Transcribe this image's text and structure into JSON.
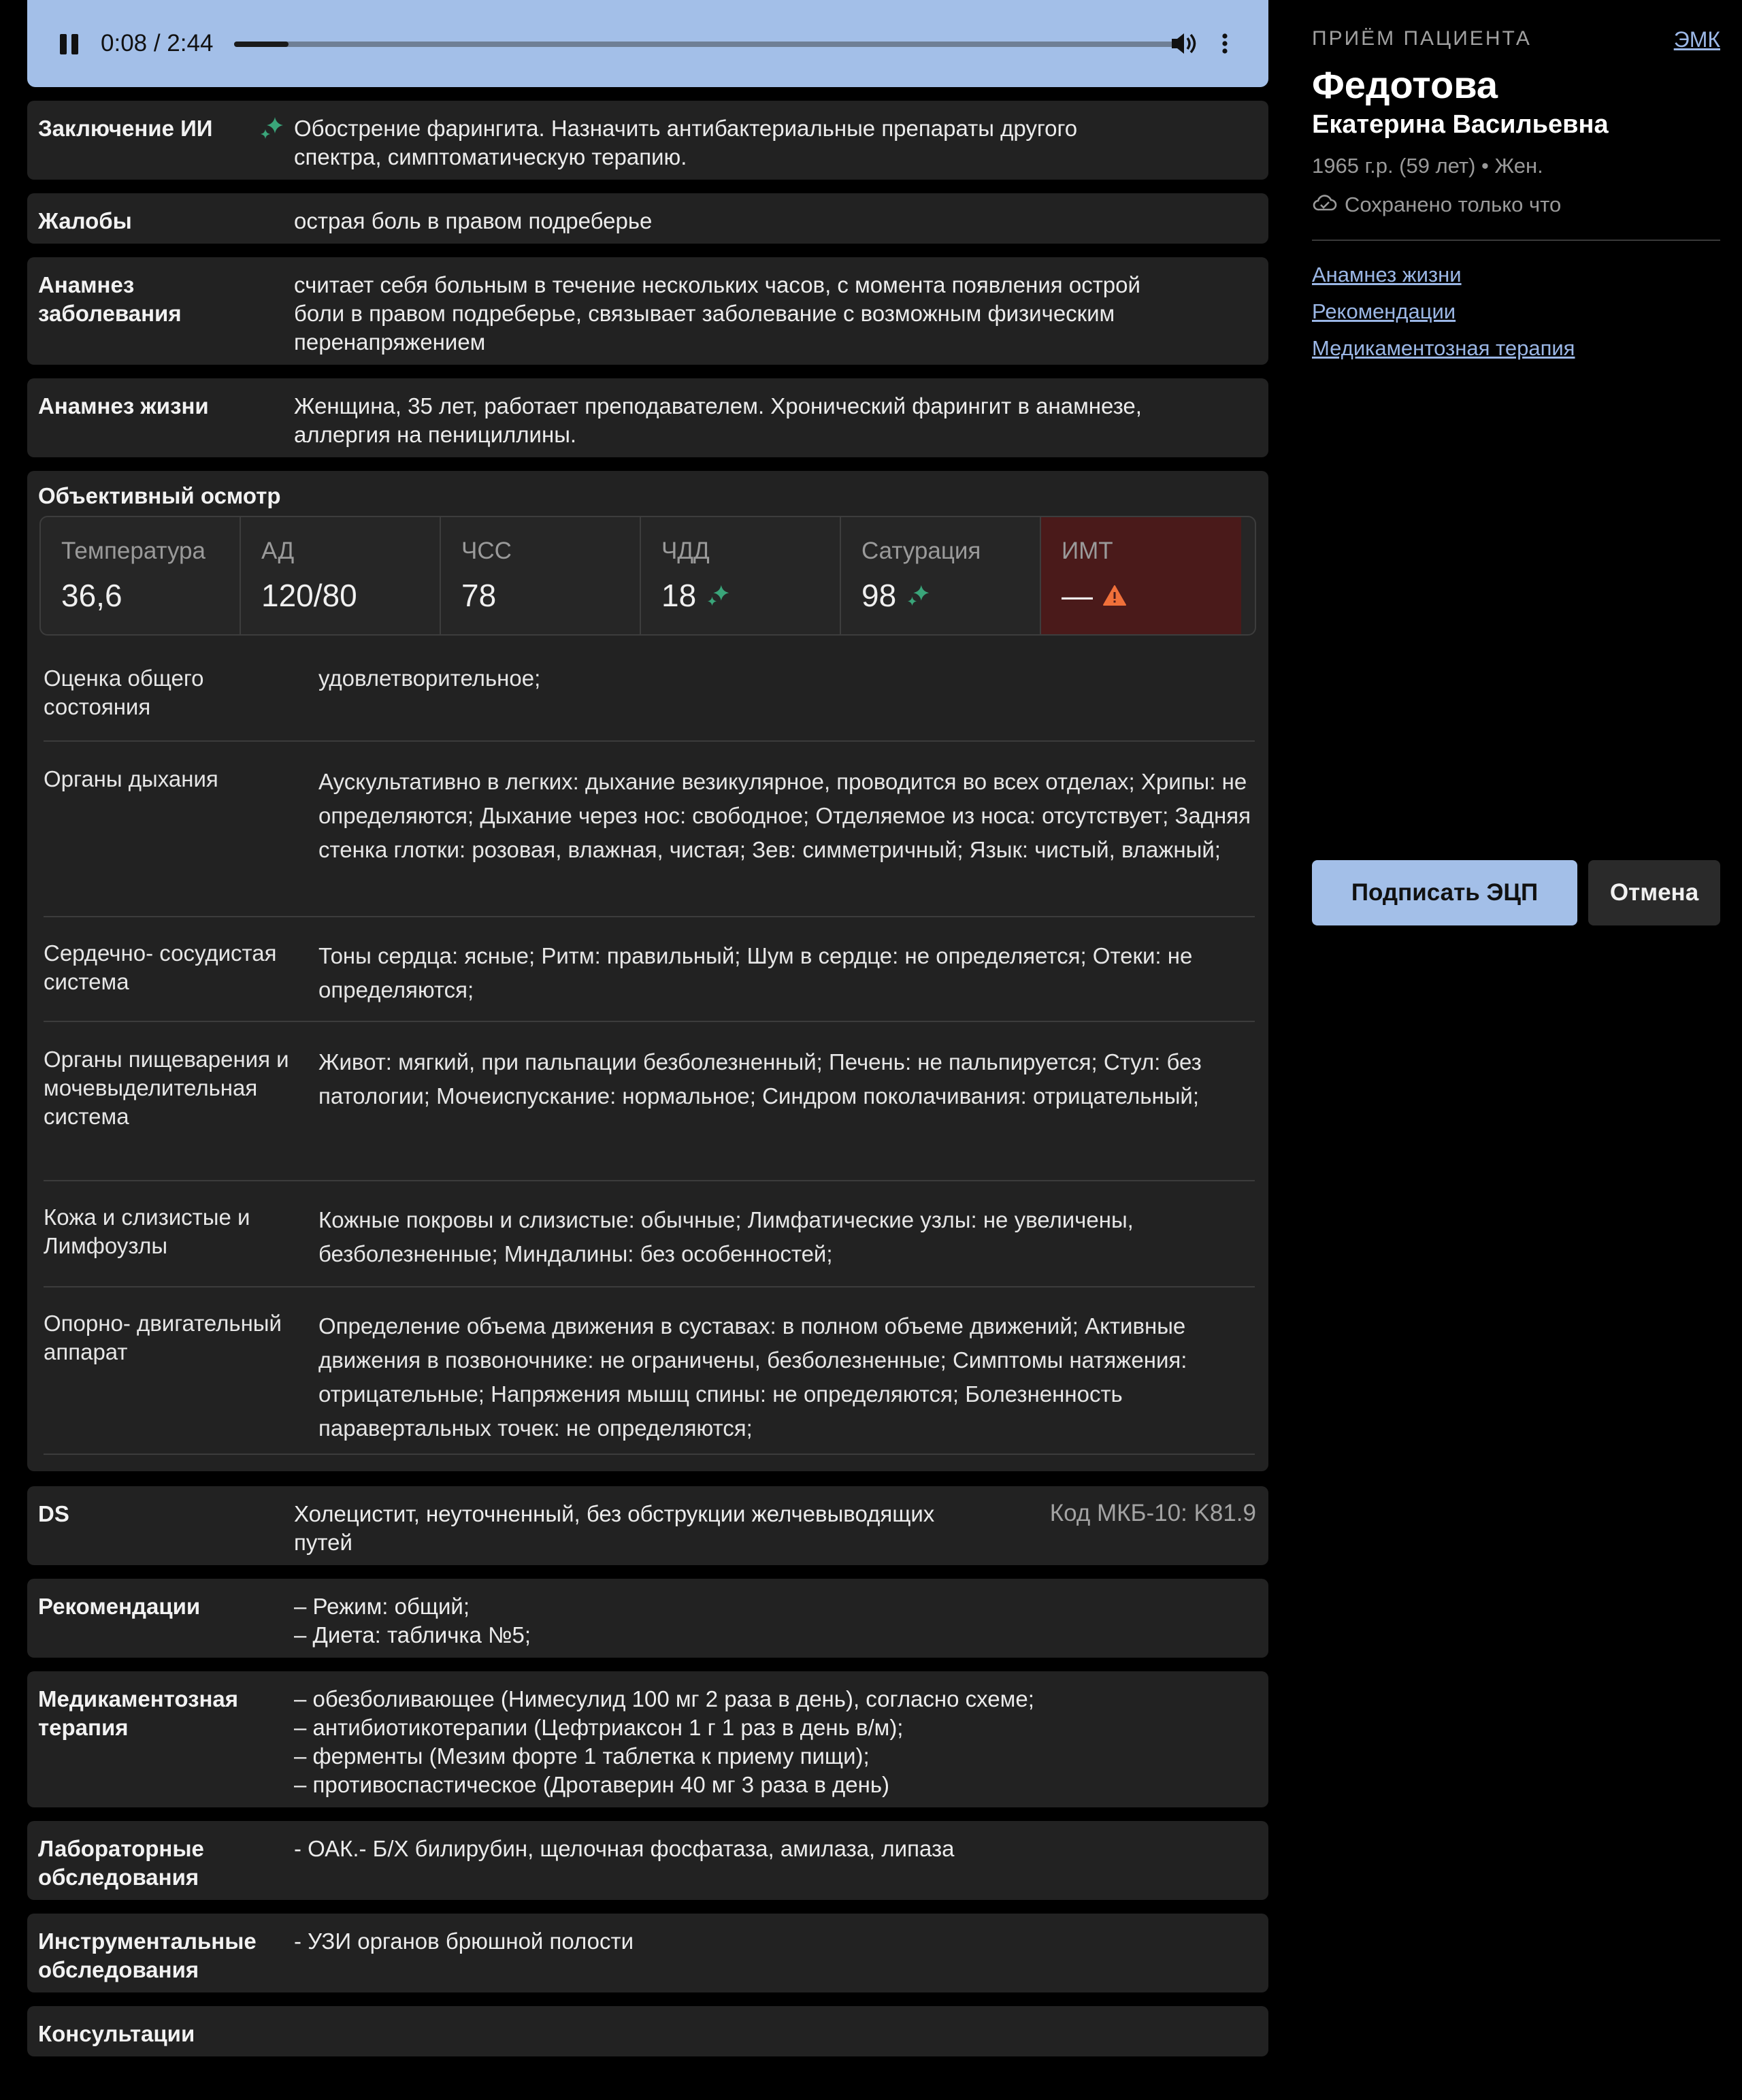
{
  "player": {
    "time": "0:08 / 2:44",
    "progress": 0.058
  },
  "ai_conclusion": {
    "label": "Заключение ИИ",
    "text": "Обострение фарингита. Назначить антибактериальные препараты другого\nспектра, симптоматическую терапию."
  },
  "complaints": {
    "label": "Жалобы",
    "text": " острая боль в правом подреберье"
  },
  "disease_history": {
    "label": "Анамнез заболевания",
    "text": " считает себя больным в течение нескольких часов, с момента появления острой\nболи в правом подреберье, связывает заболевание с возможным физическим\nперенапряжением"
  },
  "life_history": {
    "label": "Анамнез жизни",
    "text": "Женщина, 35 лет, работает преподавателем. Хронический фарингит в анамнезе,\nаллергия на пенициллины."
  },
  "exam": {
    "title": "Объективный осмотр",
    "vitals": [
      {
        "label": "Температура",
        "value": "36,6"
      },
      {
        "label": "АД",
        "value": "120/80"
      },
      {
        "label": "ЧСС",
        "value": "78"
      },
      {
        "label": "ЧДД",
        "value": " 18"
      },
      {
        "label": "Сатурация",
        "value": "98"
      },
      {
        "label": "ИМТ",
        "value": "—"
      }
    ],
    "rows": [
      {
        "label": "Оценка общего\nсостояния",
        "text": " удовлетворительное;"
      },
      {
        "label": "Органы дыхания",
        "text": "Аускультативно в легких:  дыхание везикулярное, проводится во всех отделах;\nХрипы:  не определяются; Дыхание через нос:  свободное; Отделяемое из носа:\n отсутствует; Задняя стенка глотки:  розовая, влажная, чистая; Зев:\n симметричный; Язык:  чистый, влажный;"
      },
      {
        "label": "Сердечно-\nсосудистая система",
        "text": "Тоны сердца:  ясные; Ритм:  правильный; Шум в сердце:  не определяется; Отеки:\n не определяются;"
      },
      {
        "label": "Органы\nпищеварения и\nмочевыделительная\nсистема",
        "text": "Живот:  мягкий, при пальпации безболезненный; Печень:  не пальпируется; Стул:\n без патологии; Мочеиспускание:  нормальное; Синдром поколачивания:\n отрицательный;"
      },
      {
        "label": "Кожа и слизистые и\nЛимфоузлы",
        "text": "Кожные покровы и слизистые:  обычные; Лимфатические узлы:\n не увеличены, безболезненные; Миндалины:  без особенностей;"
      },
      {
        "label": "Опорно-\nдвигательный\nаппарат",
        "text": "Определение объема движения в суставах:  в полном объеме движений;\nАктивные движения в позвоночнике:  не ограничены, безболезненные;\nСимптомы натяжения:  отрицательные; Напряжения мышц спины:\n не определяются; Болезненность паравертальных точек:  не определяются;"
      }
    ]
  },
  "ds": {
    "label": "DS",
    "text": " Холецистит, неуточненный, без обструкции желчевыводящих\nпутей",
    "code": "Код МКБ-10: K81.9"
  },
  "recommendations": {
    "label": "Рекомендации",
    "text": "– Режим: общий;\n– Диета: табличка №5;"
  },
  "therapy": {
    "label": "Медикаментозная терапия",
    "text": "– обезболивающее (Нимесулид 100 мг 2 раза в день), согласно схеме;\n– антибиотикотерапии (Цефтриаксон 1 г 1 раз в день в/м);\n– ферменты (Мезим форте 1 таблетка к приему пищи);\n– противоспастическое (Дротаверин 40 мг 3 раза в день)"
  },
  "lab": {
    "label": "Лабораторные обследования",
    "text": " - ОАК.- Б/Х билирубин, щелочная фосфатаза, амилаза, липаза"
  },
  "instrumental": {
    "label": "Инструментальные обследования",
    "text": " - УЗИ органов брюшной полости"
  },
  "consultations": {
    "label": "Консультации",
    "text": ""
  },
  "patient": {
    "header": "ПРИЁМ ПАЦИЕНТА",
    "emk": "ЭМК",
    "surname": "Федотова",
    "name": "Екатерина Васильевна",
    "meta": "1965 г.р. (59 лет)  •  Жен.",
    "saved": "Сохранено только что"
  },
  "nav_links": [
    "Анамнез жизни",
    "Рекомендации",
    "Медикаментозная терапия"
  ],
  "actions": {
    "sign": "Подписать ЭЦП",
    "cancel": "Отмена"
  },
  "colors": {
    "accent": "#a3bfe8",
    "ai_icon": "#3aa57a",
    "warning": "#f0703a",
    "alert_bg": "#4a1a1a"
  }
}
